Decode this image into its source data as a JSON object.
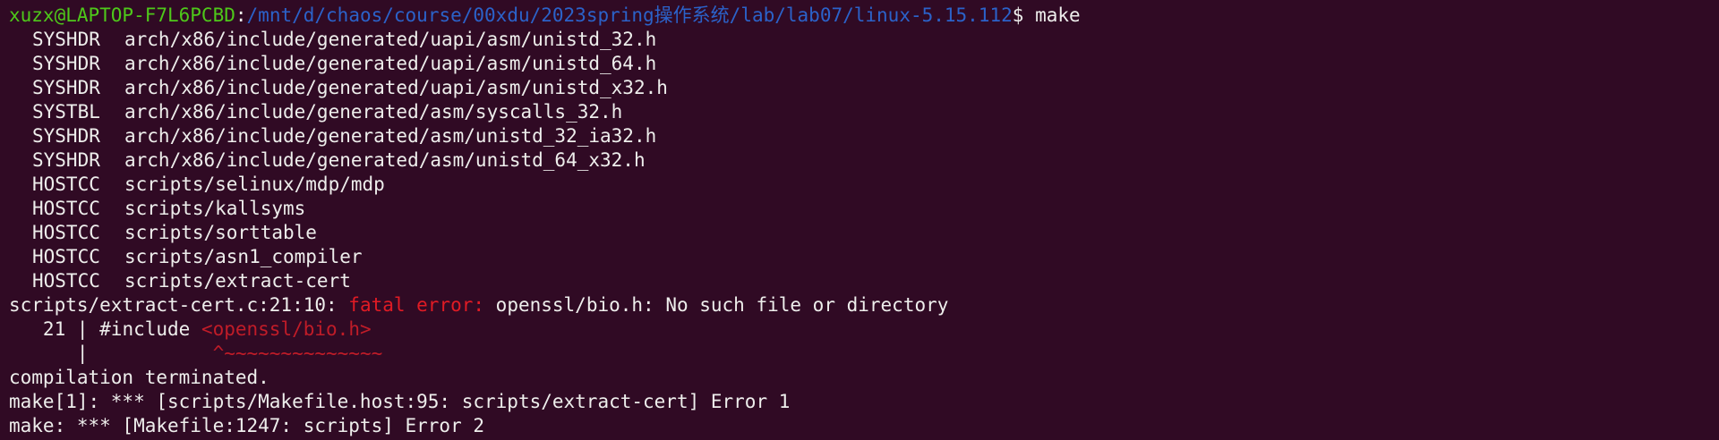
{
  "prompt": {
    "user_host": "xuzx@LAPTOP-F7L6PCBD",
    "colon": ":",
    "path": "/mnt/d/chaos/course/00xdu/2023spring操作系统/lab/lab07/linux-5.15.112",
    "dollar": "$ ",
    "command": "make"
  },
  "build_lines": [
    {
      "tag": "SYSHDR",
      "file": "arch/x86/include/generated/uapi/asm/unistd_32.h"
    },
    {
      "tag": "SYSHDR",
      "file": "arch/x86/include/generated/uapi/asm/unistd_64.h"
    },
    {
      "tag": "SYSHDR",
      "file": "arch/x86/include/generated/uapi/asm/unistd_x32.h"
    },
    {
      "tag": "SYSTBL",
      "file": "arch/x86/include/generated/asm/syscalls_32.h"
    },
    {
      "tag": "SYSHDR",
      "file": "arch/x86/include/generated/asm/unistd_32_ia32.h"
    },
    {
      "tag": "SYSHDR",
      "file": "arch/x86/include/generated/asm/unistd_64_x32.h"
    },
    {
      "tag": "HOSTCC",
      "file": "scripts/selinux/mdp/mdp"
    },
    {
      "tag": "HOSTCC",
      "file": "scripts/kallsyms"
    },
    {
      "tag": "HOSTCC",
      "file": "scripts/sorttable"
    },
    {
      "tag": "HOSTCC",
      "file": "scripts/asn1_compiler"
    },
    {
      "tag": "HOSTCC",
      "file": "scripts/extract-cert"
    }
  ],
  "error": {
    "location": "scripts/extract-cert.c:21:10: ",
    "label": "fatal error: ",
    "message": "openssl/bio.h: No such file or directory",
    "src_lineno": "   21 | ",
    "src_code": "#include ",
    "src_include": "<openssl/bio.h>",
    "marker_gutter": "      |           ",
    "marker": "^~~~~~~~~~~~~~~"
  },
  "tail": [
    "compilation terminated.",
    "make[1]: *** [scripts/Makefile.host:95: scripts/extract-cert] Error 1",
    "make: *** [Makefile:1247: scripts] Error 2"
  ]
}
